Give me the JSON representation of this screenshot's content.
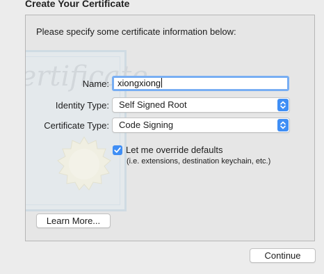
{
  "window": {
    "title": "Create Your Certificate"
  },
  "form": {
    "intro": "Please specify some certificate information below:",
    "name_label": "Name:",
    "name_value": "xiongxiong",
    "identity_type_label": "Identity Type:",
    "identity_type_value": "Self Signed Root",
    "certificate_type_label": "Certificate Type:",
    "certificate_type_value": "Code Signing",
    "override_label": "Let me override defaults",
    "override_checked": true,
    "override_help": "(i.e. extensions, destination keychain, etc.)"
  },
  "buttons": {
    "learn_more": "Learn More...",
    "continue": "Continue"
  },
  "colors": {
    "accent": "#3f8ef5",
    "focus_ring": "#78aef3",
    "window_bg": "#ececec"
  },
  "icons": {
    "stepper": "chevron-up-down-icon",
    "checkbox": "checkmark-icon",
    "background": "certificate-seal-icon"
  }
}
